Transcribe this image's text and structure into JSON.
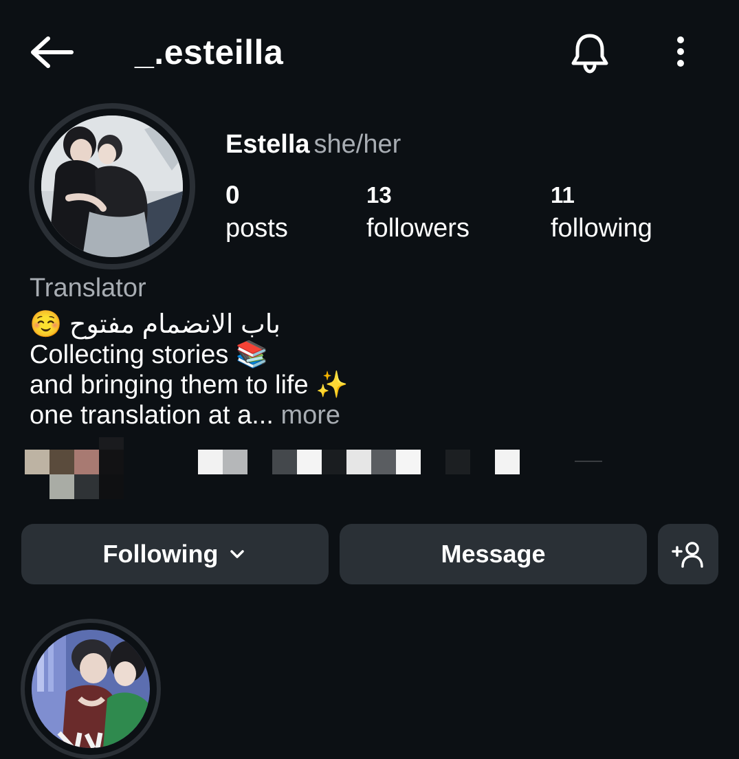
{
  "header": {
    "username": "_.esteilla",
    "back_icon": "arrow-left-icon",
    "bell_icon": "bell-icon",
    "more_icon": "vertical-dots-icon"
  },
  "profile": {
    "display_name": "Estella",
    "pronouns": "she/her",
    "stats": {
      "posts": {
        "count": "0",
        "label": "posts"
      },
      "followers": {
        "count": "13",
        "label": "followers"
      },
      "following": {
        "count": "11",
        "label": "following"
      }
    },
    "category": "Translator",
    "bio": {
      "line1": "☺️ باب الانضمام مفتوح",
      "line2": "Collecting stories 📚",
      "line3": "and bringing them to life ✨",
      "line4": "one translation at a...",
      "more": "more"
    }
  },
  "actions": {
    "following_label": "Following",
    "message_label": "Message",
    "add_user_icon": "add-person-icon"
  },
  "colors": {
    "background": "#0c1014",
    "button_bg": "#2a3036",
    "secondary_text": "#a8adb3"
  }
}
